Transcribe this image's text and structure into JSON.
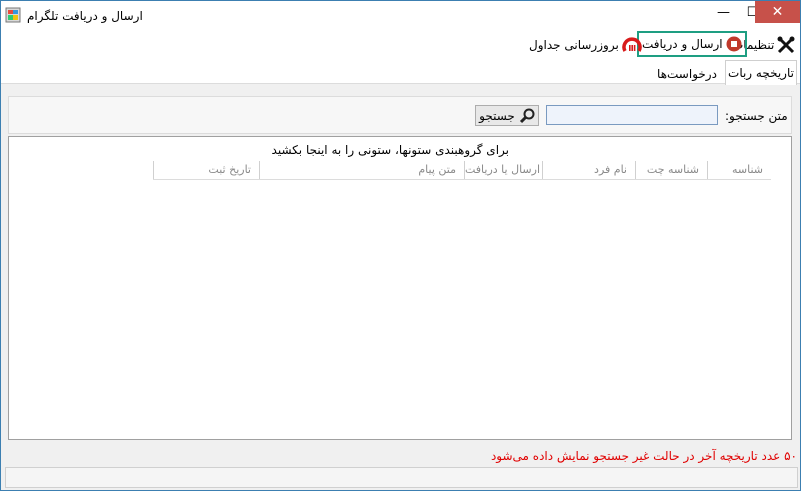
{
  "window": {
    "title": "ارسال و دریافت تلگرام",
    "minimize_symbol": "—",
    "maximize_symbol": "☐",
    "close_symbol": "✕"
  },
  "toolbar": {
    "settings_label": "تنظیمات",
    "settings_icon": "tools-icon",
    "send_receive_label": "ارسال و دریافت",
    "send_receive_icon": "stop-icon",
    "refresh_tables_label": "بروزرسانی جداول",
    "refresh_tables_icon": "refresh-gauge-icon"
  },
  "tabs": [
    {
      "label": "تاریخچه ربات",
      "selected": true
    },
    {
      "label": "درخواست‌ها",
      "selected": false
    }
  ],
  "search": {
    "label": "متن جستجو:",
    "value": "",
    "button_label": "جستجو"
  },
  "grid": {
    "group_hint": "برای گروهبندی ستونها، ستونی را به اینجا بکشید",
    "columns": [
      "شناسه",
      "شناسه چت",
      "نام فرد",
      "ارسال یا دریافت",
      "متن پیام",
      "تاریخ ثبت"
    ]
  },
  "footer_note": "۵۰ عدد تاریخچه آخر در حالت غیر جستجو نمایش داده می‌شود",
  "colors": {
    "highlight_border": "#1e9e82",
    "note_red": "#e00000",
    "close_red": "#c7514a",
    "stop_icon_red": "#c0392b"
  }
}
